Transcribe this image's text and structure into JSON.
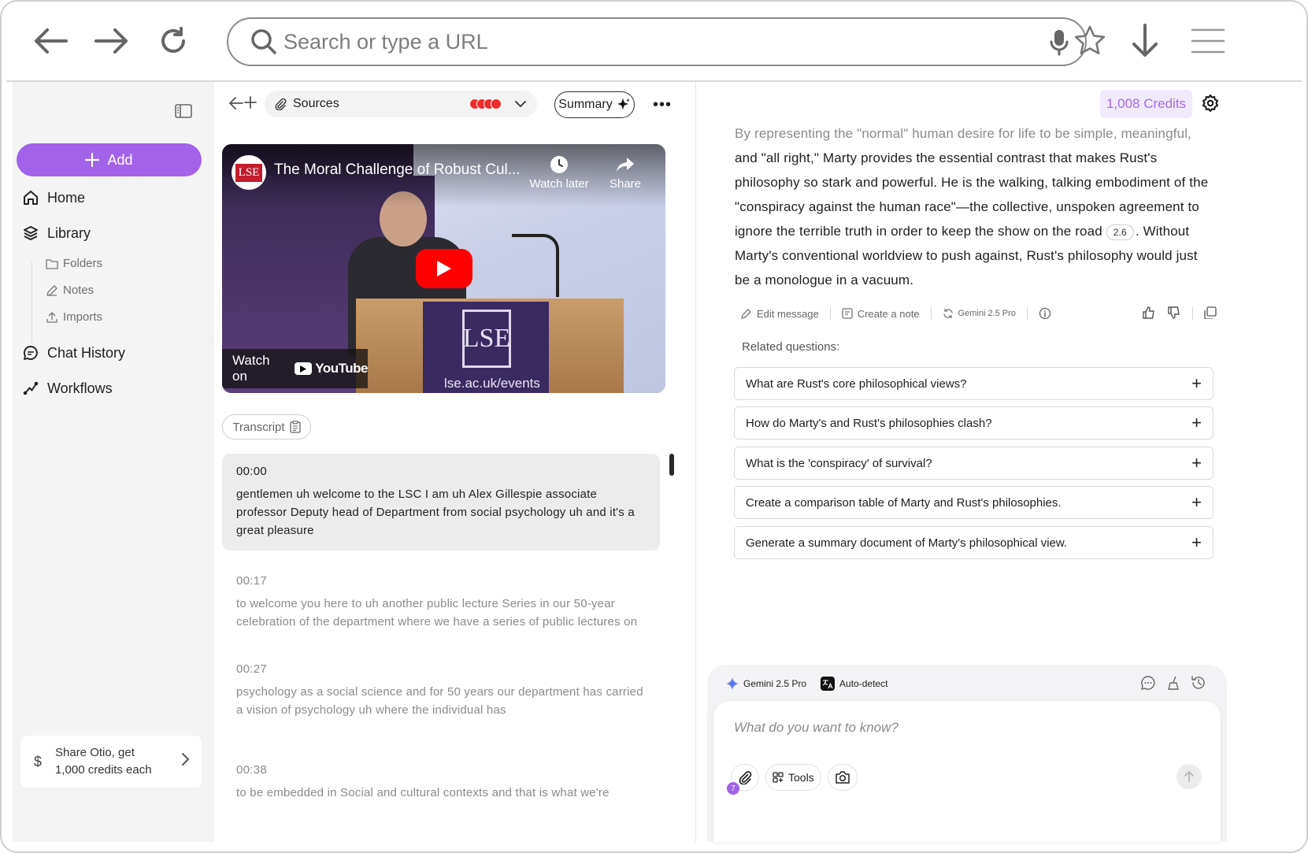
{
  "browser": {
    "url_placeholder": "Search or type a URL",
    "icons": [
      "back-arrow-icon",
      "forward-arrow-icon",
      "reload-icon",
      "search-icon",
      "microphone-icon",
      "star-icon",
      "download-icon",
      "menu-icon"
    ]
  },
  "sidebar": {
    "add_label": "Add",
    "nav": {
      "home": "Home",
      "library": "Library",
      "folders": "Folders",
      "notes": "Notes",
      "imports": "Imports",
      "chat_history": "Chat History",
      "workflows": "Workflows"
    },
    "share": {
      "symbol": "$",
      "line1": "Share Otio, get",
      "line2": "1,000 credits each"
    }
  },
  "middle": {
    "sources_label": "Sources",
    "summary_label": "Summary",
    "more_label": "•••",
    "video": {
      "channel_badge": "LSE",
      "title": "The Moral Challenge of Robust Cul...",
      "watch_later": "Watch later",
      "share": "Share",
      "watch_on": "Watch on",
      "youtube": "YouTube",
      "podium_logo": "LSE",
      "podium_url": "lse.ac.uk/events"
    },
    "transcript_label": "Transcript",
    "transcript": [
      {
        "time": "00:00",
        "text": "gentlemen uh welcome to the LSC I am uh Alex Gillespie associate professor Deputy head of Department from social psychology uh and it's a great pleasure"
      },
      {
        "time": "00:17",
        "text": "to welcome you here to uh another public lecture Series in our 50-year celebration of the department where we have a series of public lectures on"
      },
      {
        "time": "00:27",
        "text": "psychology as a social science and for 50 years our department has carried a vision of psychology uh where the individual has"
      },
      {
        "time": "00:38",
        "text": "to be embedded in Social and cultural contexts and that is what we're"
      }
    ]
  },
  "right": {
    "credits": "1,008 Credits",
    "answer": {
      "line_fade": "By representing the \"normal\" human desire for life to be simple, meaningful,",
      "body_before_cite": "and \"all right,\" Marty provides the essential contrast that makes Rust's philosophy so stark and powerful. He is the walking, talking embodiment of the \"conspiracy against the human race\"—the collective, unspoken agreement to ignore the terrible truth in order to keep the show on the road",
      "cite": "2.6",
      "body_after_cite": ". Without Marty's conventional worldview to push against, Rust's philosophy would just be a monologue in a vacuum."
    },
    "actions": {
      "edit": "Edit message",
      "note": "Create a note",
      "model": "Gemini 2.5 Pro"
    },
    "related_title": "Related questions:",
    "related": [
      "What are Rust's core philosophical views?",
      "How do Marty's and Rust's philosophies clash?",
      "What is the 'conspiracy' of survival?",
      "Create a comparison table of Marty and Rust's philosophies.",
      "Generate a summary document of Marty's philosophical view."
    ],
    "composer": {
      "model": "Gemini 2.5 Pro",
      "language": "Auto-detect",
      "placeholder": "What do you want to know?",
      "tools_label": "Tools",
      "attach_badge": "7"
    }
  },
  "colors": {
    "accent": "#a262ea",
    "credits_text": "#a56be8",
    "credits_bg": "#f1eafc",
    "youtube_red": "#ff0000"
  }
}
